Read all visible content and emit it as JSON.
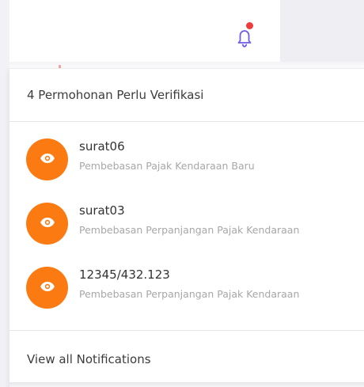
{
  "topbar": {
    "bell_icon": "bell-icon",
    "has_unread": true,
    "dot_color": "#ee3b3b"
  },
  "dropdown": {
    "header": "4 Permohonan Perlu Verifikasi",
    "items": [
      {
        "title": "surat06",
        "subtitle": "Pembebasan Pajak Kendaraan Baru",
        "icon": "eye-icon"
      },
      {
        "title": "surat03",
        "subtitle": "Pembebasan Perpanjangan Pajak Kendaraan",
        "icon": "eye-icon"
      },
      {
        "title": "12345/432.123",
        "subtitle": "Pembebasan Perpanjangan Pajak Kendaraan",
        "icon": "eye-icon"
      }
    ],
    "footer": "View all Notifications",
    "accent": "#fb7a12"
  }
}
